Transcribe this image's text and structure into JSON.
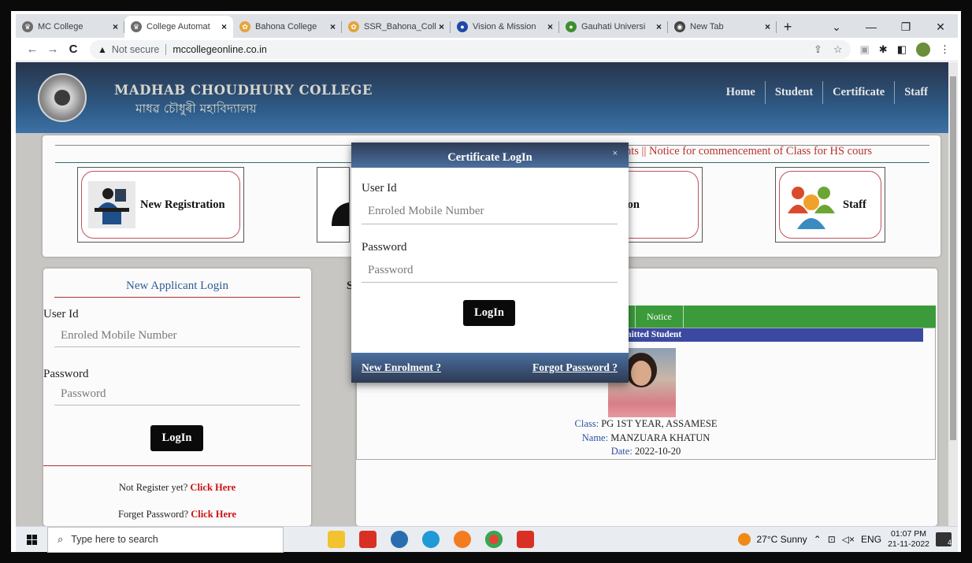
{
  "browser": {
    "tabs": [
      {
        "label": "MC College",
        "color": "#6d6d6d",
        "active": false
      },
      {
        "label": "College Automat",
        "color": "#6d6d6d",
        "active": true
      },
      {
        "label": "Bahona College",
        "color": "#e5a33a",
        "active": false
      },
      {
        "label": "SSR_Bahona_Coll",
        "color": "#e5a33a",
        "active": false
      },
      {
        "label": "Vision & Mission",
        "color": "#1d4aa8",
        "active": false
      },
      {
        "label": "Gauhati Universi",
        "color": "#3d8f2e",
        "active": false
      },
      {
        "label": "New Tab",
        "color": "#444444",
        "active": false
      }
    ],
    "tab_close_glyph": "×",
    "new_tab_glyph": "+",
    "address": {
      "security_label": "Not secure",
      "url": "mccollegeonline.co.in"
    }
  },
  "site": {
    "college_name_en": "MADHAB CHOUDHURY COLLEGE",
    "college_name_as": "মাধৱ চৌধুৰী মহাবিদ্যালয়",
    "nav": [
      "Home",
      "Student",
      "Certificate",
      "Staff"
    ],
    "ticker": "nts  ||   Notice for commencement of Class for HS cours",
    "tiles": [
      {
        "label": "New Registration"
      },
      {
        "label": "ducation"
      },
      {
        "label": "Staff"
      }
    ]
  },
  "applicant_login": {
    "title": "New Applicant Login",
    "user_label": "User Id",
    "user_placeholder": "Enroled Mobile Number",
    "password_label": "Password",
    "password_placeholder": "Password",
    "login_button": "LogIn",
    "register_text": "Not Register yet?",
    "register_link": "Click Here",
    "forgot_text": "Forget Password?",
    "forgot_link": "Click Here"
  },
  "notice_section": {
    "section_letter": "S",
    "notice_tab": "Notice",
    "bar_text": "mitted Student",
    "student": {
      "class_key": "Class:",
      "class_value": "PG 1ST YEAR, ASSAMESE",
      "name_key": "Name:",
      "name_value": "MANZUARA KHATUN",
      "date_key": "Date:",
      "date_value": "2022-10-20"
    }
  },
  "certificate_modal": {
    "title": "Certificate LogIn",
    "close_glyph": "×",
    "user_label": "User Id",
    "user_placeholder": "Enroled Mobile Number",
    "password_label": "Password",
    "password_placeholder": "Password",
    "login_button": "LogIn",
    "enrolment_link": "New Enrolment ?",
    "forgot_link": "Forgot Password ?"
  },
  "taskbar": {
    "search_placeholder": "Type here to search",
    "weather": "27°C  Sunny",
    "language": "ENG",
    "time": "01:07 PM",
    "date": "21-11-2022",
    "notification_count": "4"
  }
}
